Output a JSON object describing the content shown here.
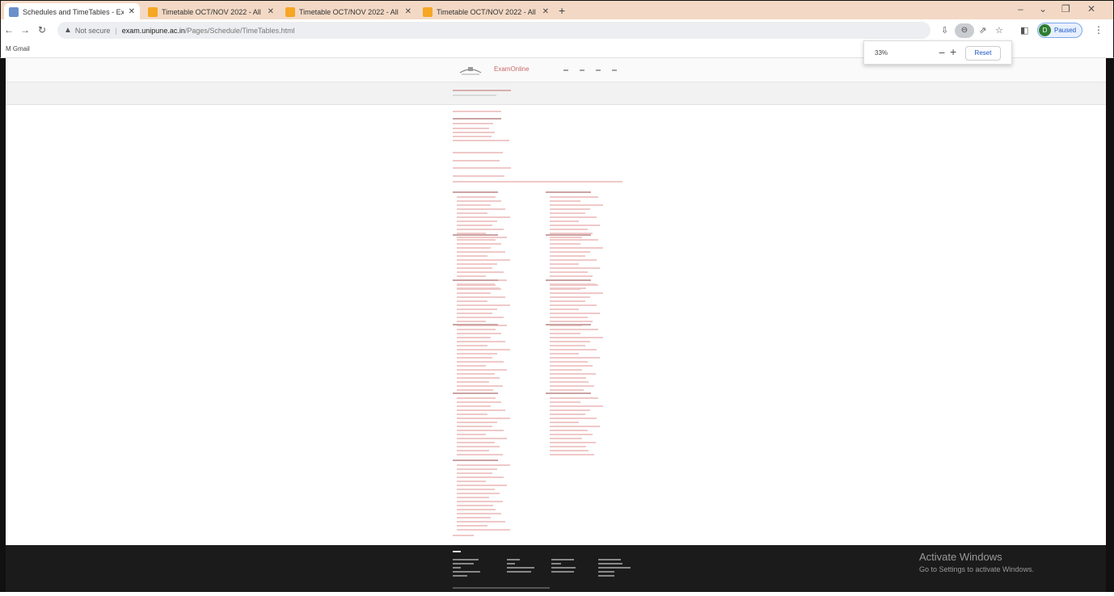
{
  "tabs": [
    {
      "title": "Schedules and TimeTables - Exam",
      "icon": "globe-icon",
      "active": true
    },
    {
      "title": "Timetable OCT/NOV 2022 - All",
      "icon": "document-icon",
      "active": false
    },
    {
      "title": "Timetable OCT/NOV 2022 - All",
      "icon": "document-icon",
      "active": false
    },
    {
      "title": "Timetable OCT/NOV 2022 - All",
      "icon": "document-icon",
      "active": false
    }
  ],
  "address": {
    "security": "Not secure",
    "host": "exam.unipune.ac.in",
    "path": "/Pages/Schedule/TimeTables.html"
  },
  "profile": {
    "label": "Paused",
    "initial": "D"
  },
  "bookmarks": [
    {
      "label": "Gmail"
    }
  ],
  "zoom": {
    "percent": "33%",
    "reset_label": "Reset"
  },
  "site": {
    "logo_text": "ExamOnline"
  },
  "overlay": {
    "activate_title": "Activate Windows",
    "activate_sub": "Go to Settings to activate Windows."
  },
  "colors": {
    "tabstrip": "#f3d9c5",
    "link_pink": "#f0c8c8",
    "footer": "#1b1b1b",
    "accent_blue": "#1a56c4"
  }
}
